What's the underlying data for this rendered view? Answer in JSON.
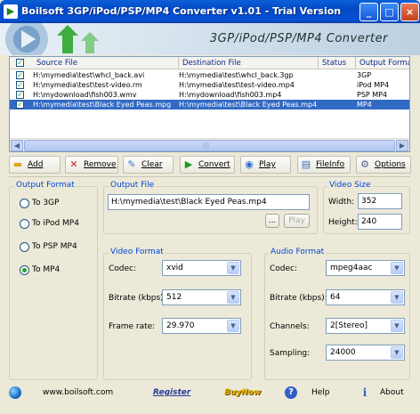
{
  "window": {
    "title": "Boilsoft 3GP/iPod/PSP/MP4 Converter v1.01 - Trial Version",
    "banner": "3GP/iPod/PSP/MP4  Converter",
    "minimize": "_",
    "maximize": "□",
    "close": "×"
  },
  "file_list": {
    "columns": [
      "Source File",
      "Destination File",
      "Status",
      "Output Format"
    ],
    "rows": [
      {
        "source": "H:\\mymedia\\test\\whcl_back.avi",
        "destination": "H:\\mymedia\\test\\whcl_back.3gp",
        "status": "",
        "format": "3GP",
        "checked": "✓"
      },
      {
        "source": "H:\\mymedia\\test\\test-video.rm",
        "destination": "H:\\mymedia\\test\\test-video.mp4",
        "status": "",
        "format": "iPod MP4",
        "checked": "✓"
      },
      {
        "source": "H:\\mydownload\\fish003.wmv",
        "destination": "H:\\mydownload\\fish003.mp4",
        "status": "",
        "format": "PSP MP4",
        "checked": "✓"
      },
      {
        "source": "H:\\mymedia\\test\\Black Eyed Peas.mpg",
        "destination": "H:\\mymedia\\test\\Black Eyed Peas.mp4",
        "status": "",
        "format": "MP4",
        "checked": "✓"
      }
    ],
    "scroll_grip": "|||"
  },
  "toolbar": {
    "add": "Add",
    "remove": "Remove",
    "clear": "Clear",
    "convert": "Convert",
    "play": "Play",
    "fileinfo": "FileInfo",
    "options": "Options"
  },
  "output_format": {
    "label": "Output Format",
    "options": [
      "To 3GP",
      "To iPod MP4",
      "To PSP MP4",
      "To MP4"
    ],
    "selected": "To MP4"
  },
  "output_file": {
    "label": "Output File",
    "value": "H:\\mymedia\\test\\Black Eyed Peas.mp4",
    "browse": "...",
    "play": "Play"
  },
  "video_size": {
    "label": "Video Size",
    "width_label": "Width:",
    "width": "352",
    "height_label": "Height:",
    "height": "240"
  },
  "video_format": {
    "label": "Video Format",
    "codec_label": "Codec:",
    "codec": "xvid",
    "bitrate_label": "Bitrate (kbps):",
    "bitrate": "512",
    "framerate_label": "Frame rate:",
    "framerate": "29.970"
  },
  "audio_format": {
    "label": "Audio Format",
    "codec_label": "Codec:",
    "codec": "mpeg4aac",
    "bitrate_label": "Bitrate (kbps):",
    "bitrate": "64",
    "channels_label": "Channels:",
    "channels": "2[Stereo]",
    "sampling_label": "Sampling:",
    "sampling": "24000"
  },
  "footer": {
    "website": "www.boilsoft.com",
    "register": "Register",
    "buynow": "BuyNow",
    "help": "Help",
    "about": "About"
  },
  "colors": {
    "titlebar": "#0550d8",
    "selection": "#316ac5",
    "group_label": "#0046d5",
    "buynow": "#e8b400"
  }
}
